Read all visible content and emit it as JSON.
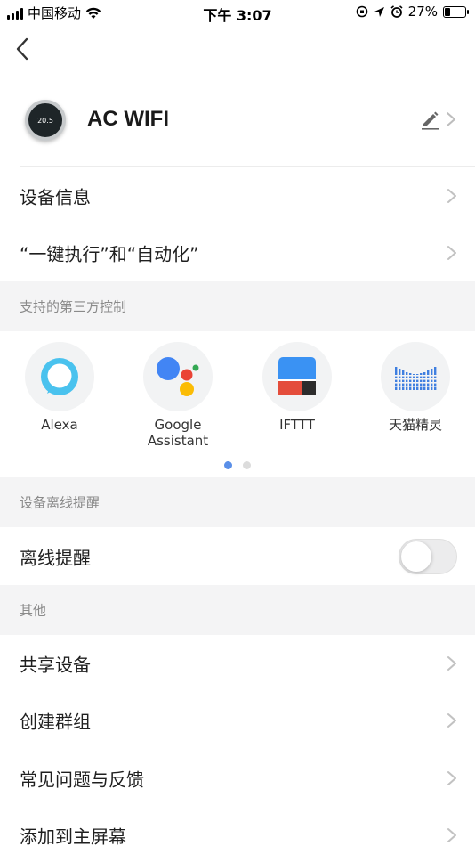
{
  "status_bar": {
    "carrier": "中国移动",
    "time": "下午 3:07",
    "battery": "27%"
  },
  "device": {
    "name": "AC WIFI",
    "display_value": "20.5"
  },
  "rows": {
    "device_info": "设备信息",
    "scene_automation": "“一键执行”和“自动化”"
  },
  "sections": {
    "third_party": "支持的第三方控制",
    "offline_alert": "设备离线提醒",
    "other": "其他"
  },
  "third_party_services": [
    {
      "label": "Alexa"
    },
    {
      "label": "Google\nAssistant"
    },
    {
      "label": "IFTTT"
    },
    {
      "label": "天猫精灵"
    }
  ],
  "pagination": {
    "current": 1,
    "total": 2
  },
  "offline": {
    "label": "离线提醒",
    "enabled": false
  },
  "other_rows": {
    "share": "共享设备",
    "create_group": "创建群组",
    "faq": "常见问题与反馈",
    "add_home": "添加到主屏幕"
  },
  "colors": {
    "accent": "#5a8fe8",
    "section_bg": "#f4f4f5",
    "alexa": "#4ac2ee",
    "google_blue": "#4285f4",
    "google_red": "#ea4335",
    "google_yellow": "#fbbc05",
    "google_green": "#34a853"
  }
}
